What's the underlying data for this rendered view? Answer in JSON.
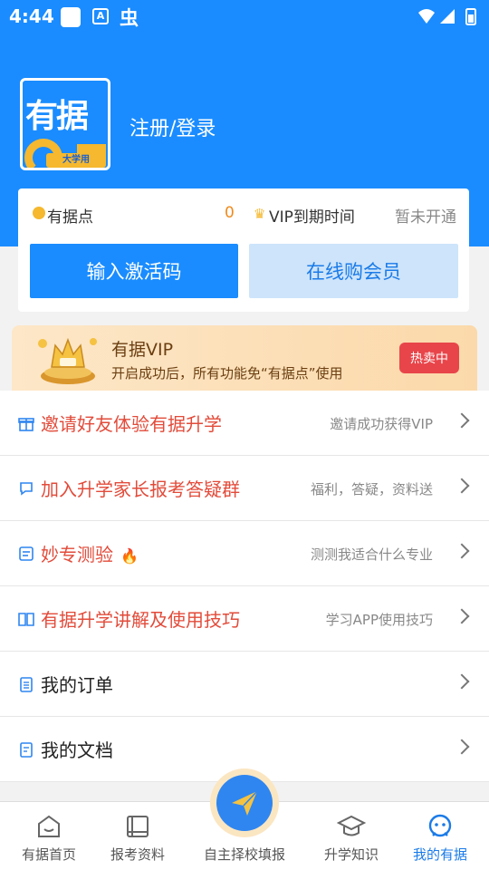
{
  "status_bar": {
    "time": "4:44",
    "a_glyph": "A",
    "bug_glyph": "虫"
  },
  "logo": {
    "text": "有据",
    "tagline": "大学用"
  },
  "header": {
    "login_label": "注册/登录"
  },
  "account": {
    "points_label": "有据点",
    "points_value": "0",
    "vip_label": "VIP到期时间",
    "vip_value": "暂未开通",
    "activate_label": "输入激活码",
    "buy_label": "在线购会员"
  },
  "vip_banner": {
    "title": "有据VIP",
    "description": "开启成功后，所有功能免“有据点”使用",
    "badge": "热卖中"
  },
  "menu": [
    {
      "label": "邀请好友体验有据升学",
      "sub": "邀请成功获得VIP",
      "icon": "gift-icon"
    },
    {
      "label": "加入升学家长报考答疑群",
      "sub": "福利，答疑，资料送",
      "icon": "chat-icon"
    },
    {
      "label": "妙专测验",
      "sub": "测测我适合什么专业",
      "icon": "quiz-icon"
    },
    {
      "label": "有据升学讲解及使用技巧",
      "sub": "学习APP使用技巧",
      "icon": "book-icon"
    },
    {
      "label": "我的订单",
      "sub": "",
      "icon": "order-icon"
    },
    {
      "label": "我的文档",
      "sub": "",
      "icon": "document-icon"
    }
  ],
  "tabs": [
    {
      "label": "有据首页",
      "icon": "home-icon"
    },
    {
      "label": "报考资料",
      "icon": "books-icon"
    },
    {
      "label": "自主择校填报",
      "icon": "send-icon"
    },
    {
      "label": "升学知识",
      "icon": "graduation-cap-icon"
    },
    {
      "label": "我的有据",
      "icon": "profile-icon"
    }
  ],
  "colors": {
    "brand_blue": "#1a8cff",
    "accent_red": "#e24b3a",
    "vip_gold": "#f5b82e"
  }
}
